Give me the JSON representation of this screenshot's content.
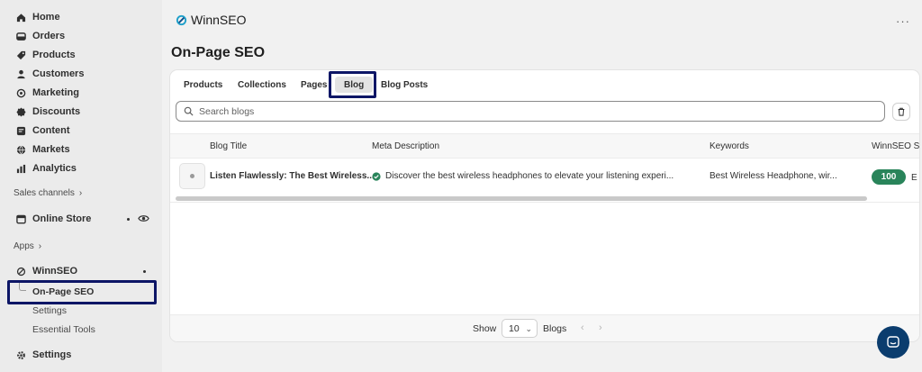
{
  "sidebar": {
    "items": [
      {
        "label": "Home",
        "icon": "home-icon"
      },
      {
        "label": "Orders",
        "icon": "orders-icon"
      },
      {
        "label": "Products",
        "icon": "tag-icon"
      },
      {
        "label": "Customers",
        "icon": "person-icon"
      },
      {
        "label": "Marketing",
        "icon": "target-icon"
      },
      {
        "label": "Discounts",
        "icon": "discount-icon"
      },
      {
        "label": "Content",
        "icon": "content-icon"
      },
      {
        "label": "Markets",
        "icon": "globe-icon"
      },
      {
        "label": "Analytics",
        "icon": "analytics-icon"
      }
    ],
    "sales_channels_label": "Sales channels",
    "online_store_label": "Online Store",
    "apps_label": "Apps",
    "app_name": "WinnSEO",
    "app_sub_items": [
      "On-Page SEO",
      "Settings",
      "Essential Tools"
    ],
    "settings_label": "Settings"
  },
  "header": {
    "app_title": "WinnSEO",
    "more_label": "···"
  },
  "page": {
    "title": "On-Page SEO"
  },
  "tabs": [
    "Products",
    "Collections",
    "Pages",
    "Blog",
    "Blog Posts"
  ],
  "active_tab": "Blog",
  "search": {
    "placeholder": "Search blogs"
  },
  "table": {
    "columns": [
      "Blog Title",
      "Meta Description",
      "Keywords",
      "WinnSEO S"
    ],
    "rows": [
      {
        "title": "Listen Flawlessly: The Best Wireless...",
        "meta_description": "Discover the best wireless headphones to elevate your listening experi...",
        "keywords": "Best Wireless Headphone, wir...",
        "score": "100",
        "score_extra": "E"
      }
    ]
  },
  "footer": {
    "show_label": "Show",
    "page_size": "10",
    "items_label": "Blogs",
    "prev": "‹",
    "next": "›"
  },
  "colors": {
    "highlight": "#0d1666",
    "score_badge": "#29845a",
    "chat_button": "#0b3d6e"
  }
}
